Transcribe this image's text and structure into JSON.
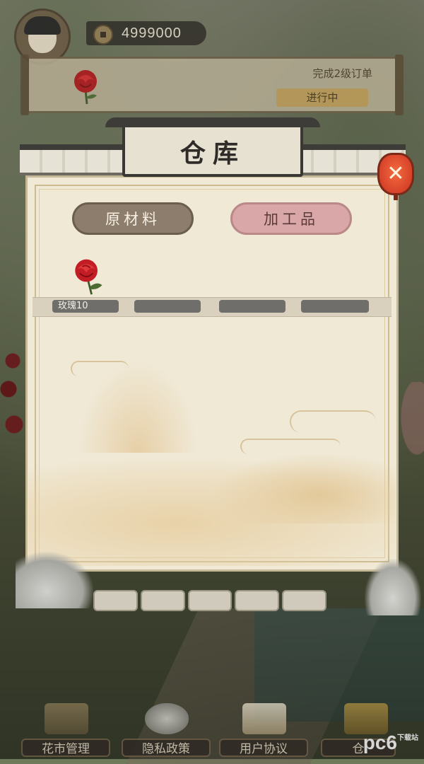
{
  "player": {
    "coins": "4999000"
  },
  "order": {
    "description": "完成2级订单",
    "status": "进行中"
  },
  "warehouse": {
    "title": "仓库",
    "tabs": [
      {
        "label": "原材料",
        "active": true
      },
      {
        "label": "加工品",
        "active": false
      }
    ],
    "items": [
      {
        "name_count": "玫瑰10",
        "icon": "rose-icon"
      },
      {
        "name_count": "",
        "icon": ""
      },
      {
        "name_count": "",
        "icon": ""
      },
      {
        "name_count": "",
        "icon": ""
      }
    ]
  },
  "bottom_nav": [
    {
      "label": "花市管理",
      "icon": "flower-market-icon"
    },
    {
      "label": "隐私政策",
      "icon": "dove-icon"
    },
    {
      "label": "用户协议",
      "icon": "scroll-icon"
    },
    {
      "label": "仓",
      "icon": "warehouse-icon"
    }
  ],
  "watermark": {
    "text": "pc6",
    "subtext": "下载站"
  },
  "colors": {
    "tab_raw": "#8d7d6c",
    "tab_processed": "#d9a7a8",
    "close_button": "#d8432a",
    "panel_bg": "#f0e9d6"
  }
}
